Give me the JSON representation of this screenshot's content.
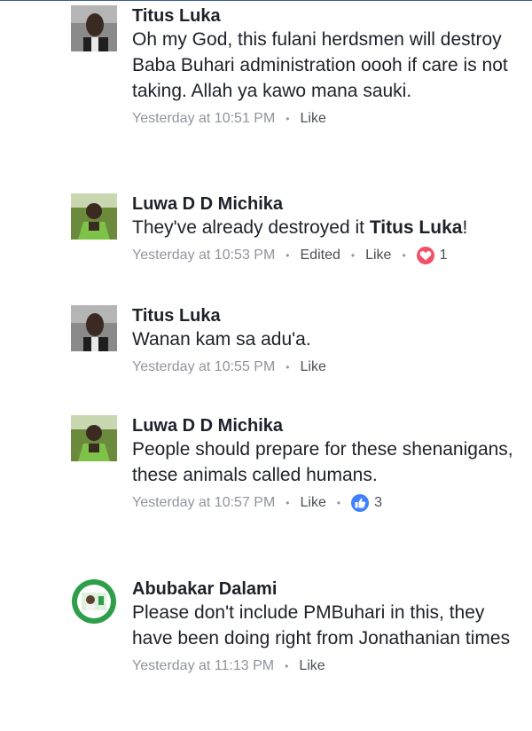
{
  "comments": [
    {
      "author": "Titus Luka",
      "text": "Oh my God, this fulani herdsmen will destroy Baba Buhari administration oooh if care is not taking. Allah ya kawo mana sauki.",
      "time": "Yesterday at 10:51 PM",
      "like_label": "Like"
    },
    {
      "author": "Luwa D D Michika",
      "text_pre": "They've already destroyed it ",
      "mention": "Titus Luka",
      "text_post": "!",
      "time": "Yesterday at 10:53 PM",
      "edited_label": "Edited",
      "like_label": "Like",
      "reaction_icon": "heart-icon",
      "reaction_color": "#f25268",
      "reaction_count": "1"
    },
    {
      "author": "Titus Luka",
      "text": "Wanan kam sa adu'a.",
      "time": "Yesterday at 10:55 PM",
      "like_label": "Like"
    },
    {
      "author": "Luwa D D Michika",
      "text": "People should prepare for these shenanigans, these animals called humans.",
      "time": "Yesterday at 10:57 PM",
      "like_label": "Like",
      "reaction_icon": "thumbs-up-icon",
      "reaction_color": "#4080ff",
      "reaction_count": "3"
    },
    {
      "author": "Abubakar Dalami",
      "text": "Please don't include PMBuhari in this, they have been doing right from Jonathanian times",
      "time": "Yesterday at 11:13 PM",
      "like_label": "Like"
    }
  ],
  "separator": "•"
}
